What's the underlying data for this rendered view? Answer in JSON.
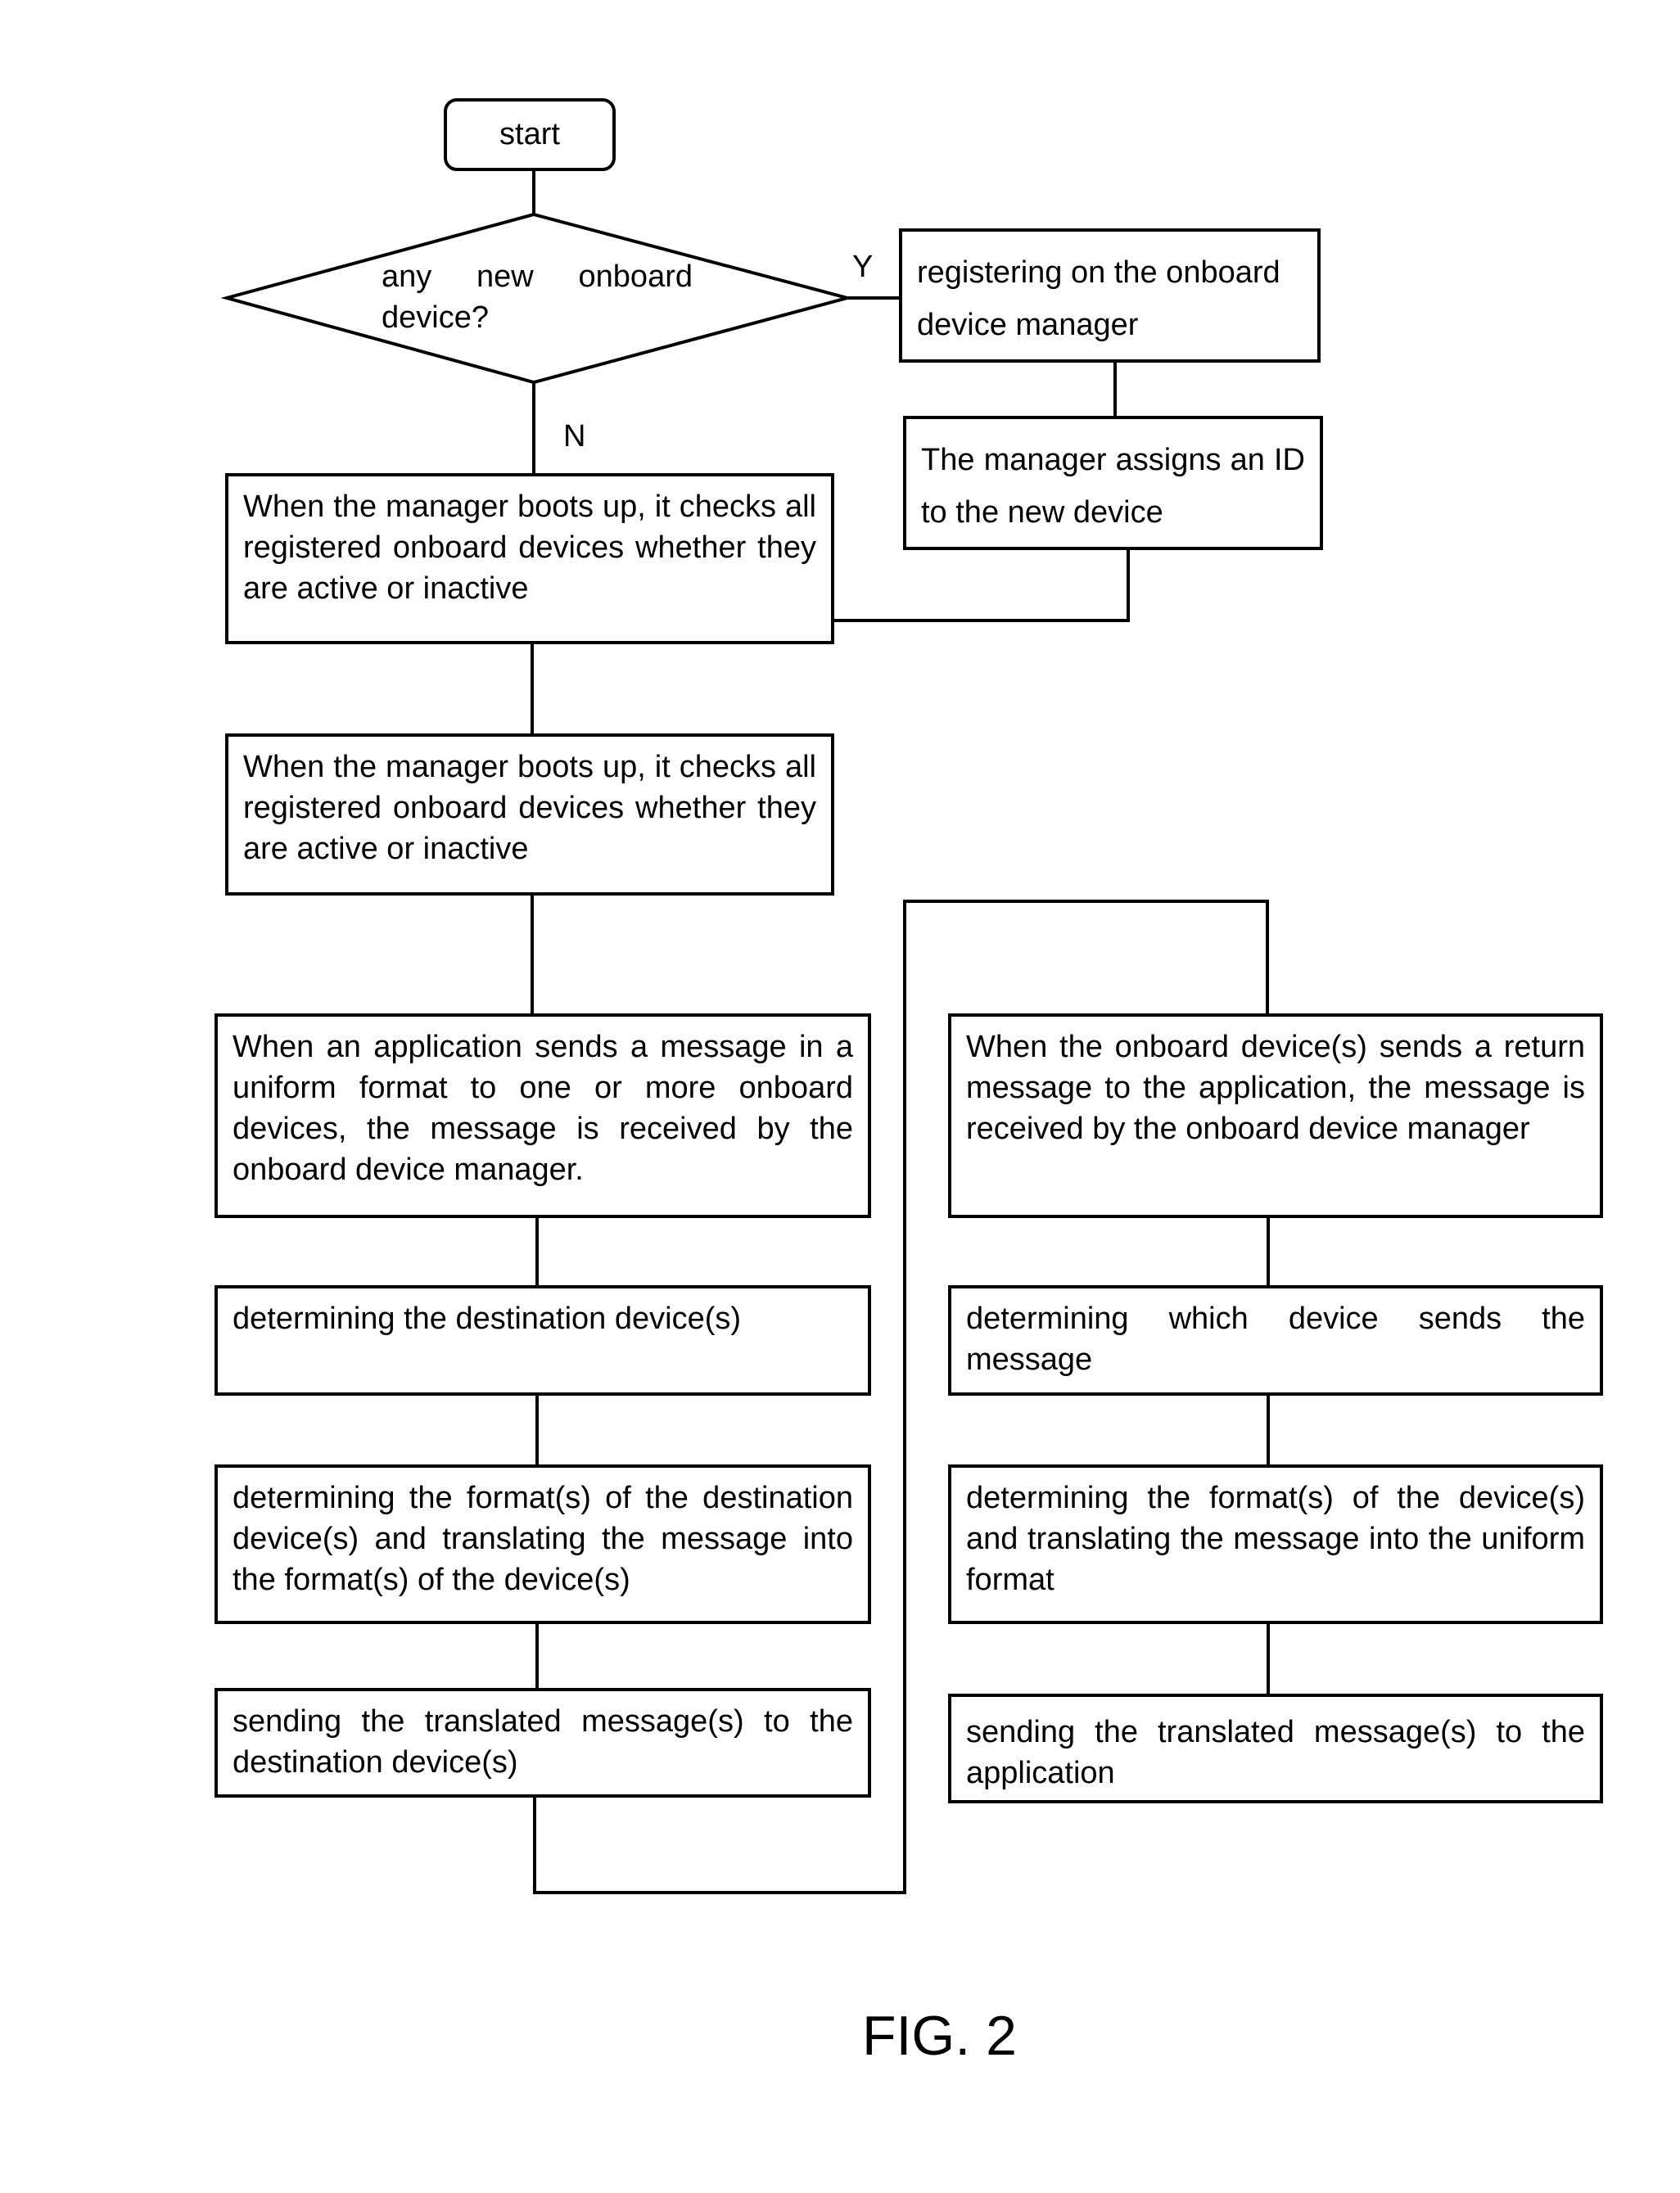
{
  "figure": {
    "caption": "FIG. 2"
  },
  "flowchart": {
    "start": "start",
    "decision": {
      "question": "any new onboard device?",
      "yes_label": "Y",
      "no_label": "N"
    },
    "yes_branch": [
      "registering on the onboard device manager",
      "The manager assigns an ID to the new device"
    ],
    "main_steps": [
      "When the manager boots up, it checks all registered onboard devices whether they are active or inactive",
      "When the manager boots up, it checks all registered onboard devices whether they are active or inactive"
    ],
    "outgoing_flow": [
      "When an application sends a message in a uniform format to one or more onboard devices, the message is received by the onboard device manager.",
      "determining the destination device(s)",
      "determining the format(s) of the destination device(s) and translating the message into the format(s) of the device(s)",
      "sending the translated message(s) to the destination device(s)"
    ],
    "return_flow": [
      "When the onboard device(s) sends a return message to the application, the message is received by the onboard device manager",
      "determining which device sends the message",
      "determining the format(s) of the device(s) and translating the message into the uniform format",
      "sending the translated message(s) to the application"
    ]
  }
}
